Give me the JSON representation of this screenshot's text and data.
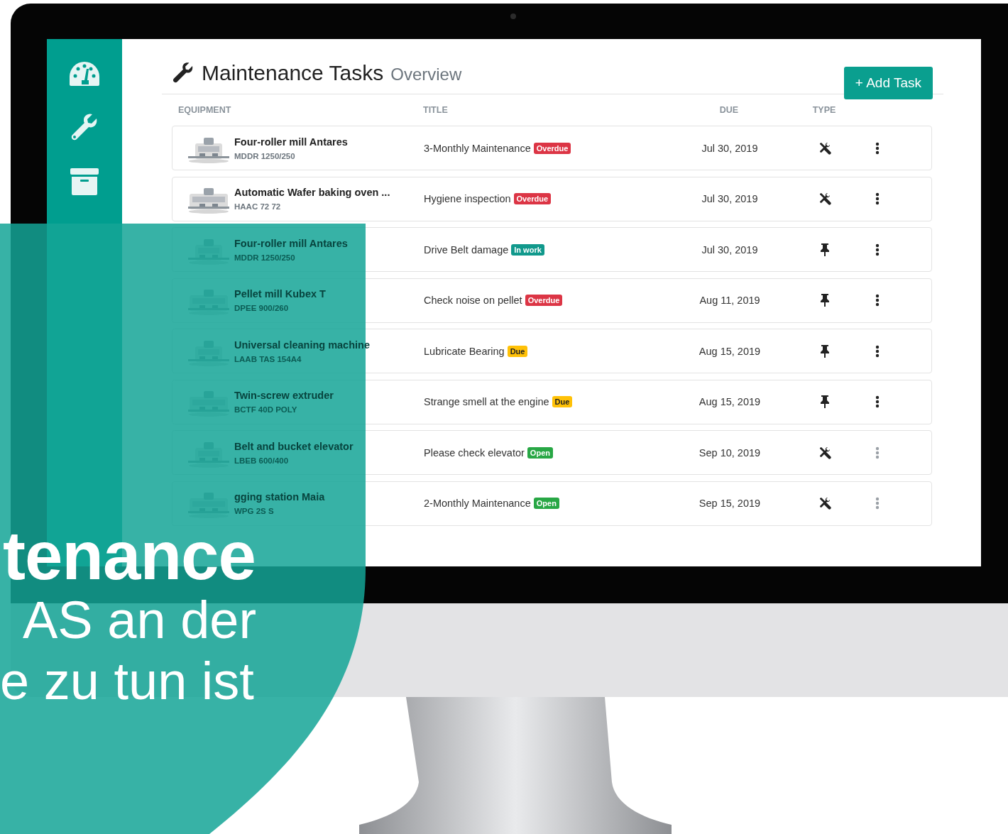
{
  "sidebar": {
    "items": [
      {
        "kind": "gauge"
      },
      {
        "kind": "wrench"
      },
      {
        "kind": "archive"
      }
    ]
  },
  "header": {
    "title": "Maintenance Tasks",
    "subtitle": "Overview",
    "button": "+ Add Task"
  },
  "table": {
    "columns": [
      "EQUIPMENT",
      "TITLE",
      "DUE",
      "TYPE"
    ],
    "rows": [
      {
        "equipment": "Four-roller mill Antares",
        "code": "MDDR 1250/250",
        "title": "3-Monthly Maintenance",
        "badge": {
          "text": "Overdue",
          "kind": "overdue"
        },
        "due": "Jul 30, 2019",
        "kind": "tools",
        "menu_disabled": false
      },
      {
        "equipment": "Automatic Wafer baking oven ...",
        "code": "HAAC 72 72",
        "title": "Hygiene inspection",
        "badge": {
          "text": "Overdue",
          "kind": "overdue"
        },
        "due": "Jul 30, 2019",
        "kind": "tools",
        "menu_disabled": false
      },
      {
        "equipment": "Four-roller mill Antares",
        "code": "MDDR 1250/250",
        "title": "Drive Belt damage",
        "badge": {
          "text": "In work",
          "kind": "in_work"
        },
        "due": "Jul 30, 2019",
        "kind": "pin",
        "menu_disabled": false
      },
      {
        "equipment": "Pellet mill Kubex T",
        "code": "DPEE 900/260",
        "title": "Check noise on pellet",
        "badge": {
          "text": "Overdue",
          "kind": "overdue"
        },
        "due": "Aug 11, 2019",
        "kind": "pin",
        "menu_disabled": false
      },
      {
        "equipment": "Universal cleaning machine",
        "code": "LAAB TAS 154A4",
        "title": "Lubricate Bearing",
        "badge": {
          "text": "Due",
          "kind": "due"
        },
        "due": "Aug 15, 2019",
        "kind": "pin",
        "menu_disabled": false
      },
      {
        "equipment": "Twin-screw extruder",
        "code": "BCTF 40D POLY",
        "title": "Strange smell at the engine",
        "badge": {
          "text": "Due",
          "kind": "due"
        },
        "due": "Aug 15, 2019",
        "kind": "pin",
        "menu_disabled": false
      },
      {
        "equipment": "Belt and bucket elevator",
        "code": "LBEB 600/400",
        "title": "Please check elevator",
        "badge": {
          "text": "Open",
          "kind": "open"
        },
        "due": "Sep 10, 2019",
        "kind": "tools",
        "menu_disabled": true
      },
      {
        "equipment": "gging station Maia",
        "code": "WPG 2S S",
        "title": "2-Monthly Maintenance",
        "badge": {
          "text": "Open",
          "kind": "open"
        },
        "due": "Sep 15, 2019",
        "kind": "tools",
        "menu_disabled": true
      }
    ]
  },
  "banner": {
    "lines": [
      "tenance",
      "AS an der",
      "e zu tun ist"
    ]
  }
}
